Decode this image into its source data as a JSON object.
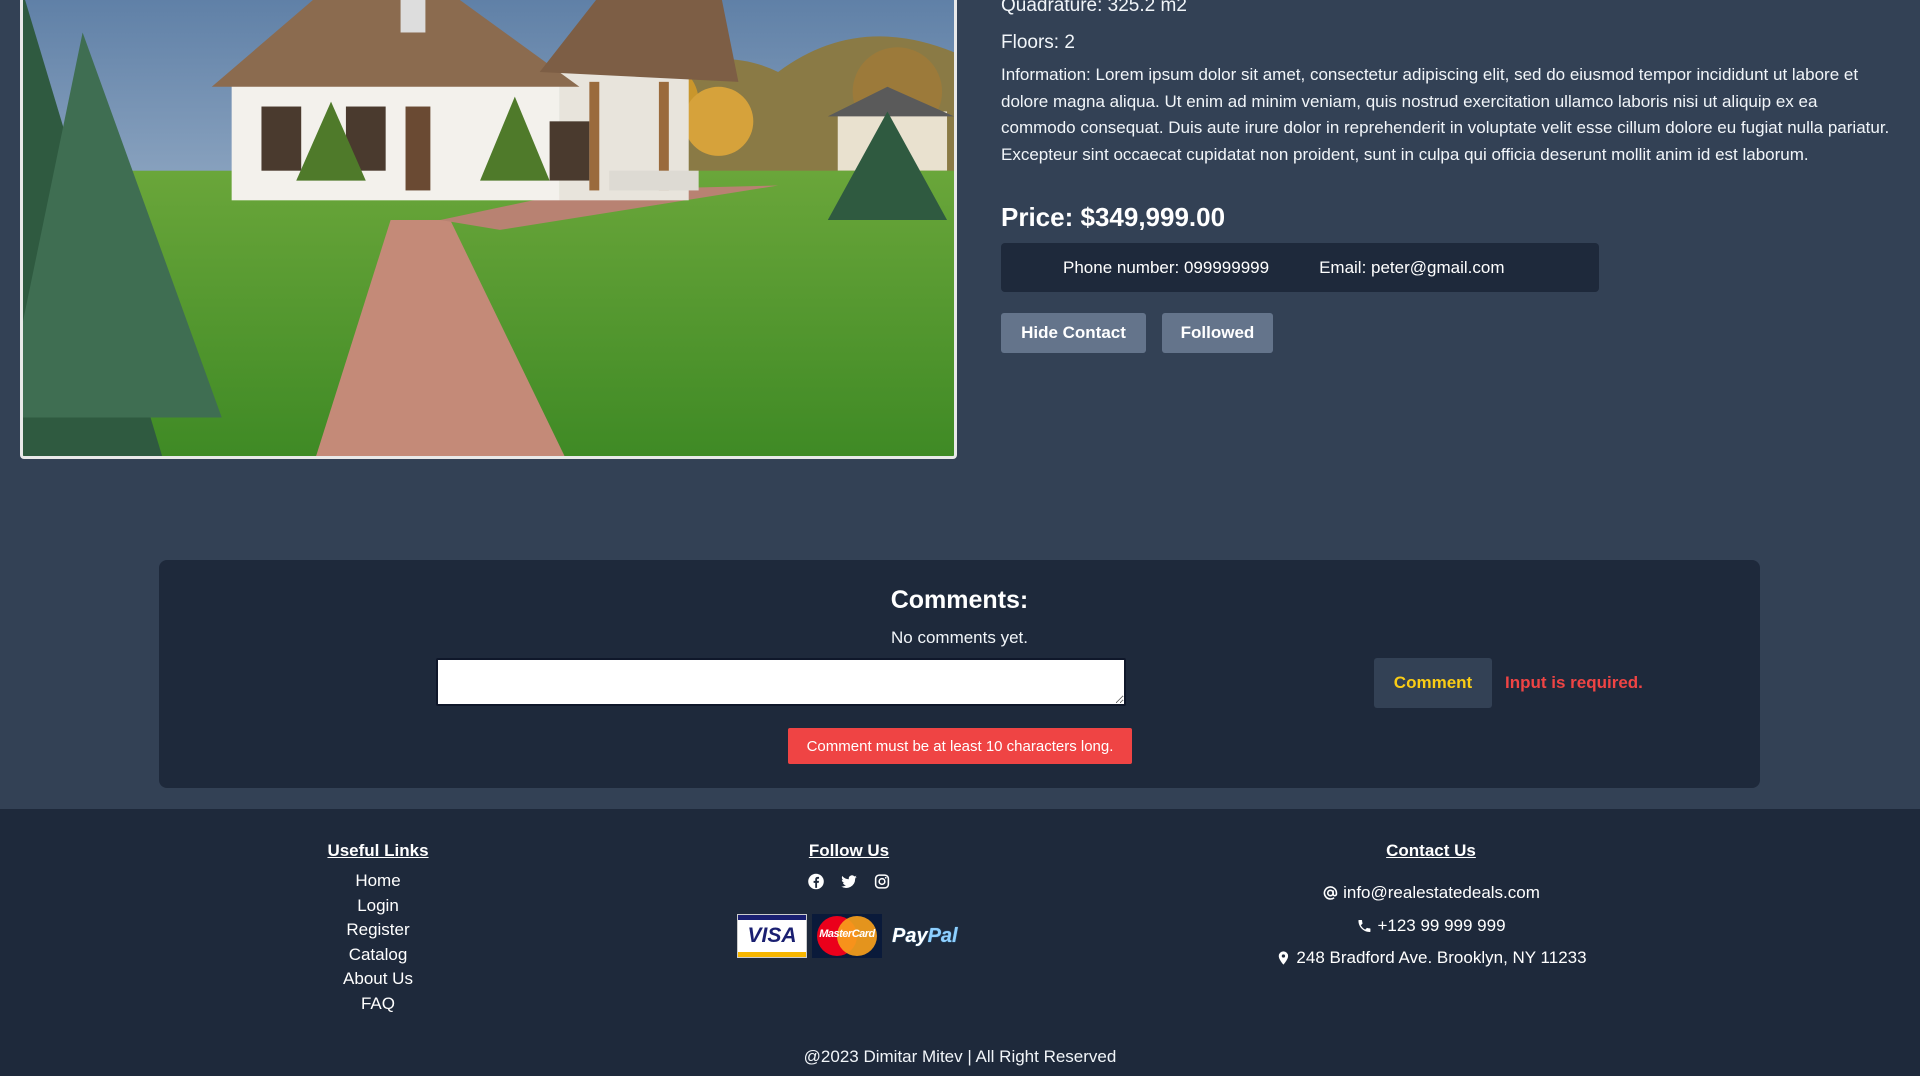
{
  "property": {
    "quadrature": "Quadrature: 325.2 m2",
    "floors": "Floors: 2",
    "information": "Information: Lorem ipsum dolor sit amet, consectetur adipiscing elit, sed do eiusmod tempor incididunt ut labore et dolore magna aliqua. Ut enim ad minim veniam, quis nostrud exercitation ullamco laboris nisi ut aliquip ex ea commodo consequat. Duis aute irure dolor in reprehenderit in voluptate velit esse cillum dolore eu fugiat nulla pariatur. Excepteur sint occaecat cupidatat non proident, sunt in culpa qui officia deserunt mollit anim id est laborum.",
    "price": "Price: $349,999.00",
    "phone": "Phone number: 099999999",
    "email": "Email: peter@gmail.com"
  },
  "actions": {
    "hide_contact": "Hide Contact",
    "followed": "Followed"
  },
  "comments": {
    "title": "Comments:",
    "empty_text": "No comments yet.",
    "input_value": "",
    "submit_label": "Comment",
    "required_message": "Input is required.",
    "length_error": "Comment must be at least 10 characters long."
  },
  "footer": {
    "useful_links_title": "Useful Links",
    "links": [
      "Home",
      "Login",
      "Register",
      "Catalog",
      "About Us",
      "FAQ"
    ],
    "follow_title": "Follow Us",
    "social_icons": [
      "facebook-icon",
      "twitter-icon",
      "instagram-icon"
    ],
    "payments": {
      "visa": "VISA",
      "mastercard": "MasterCard",
      "paypal_pay": "Pay",
      "paypal_pal": "Pal"
    },
    "contact_title": "Contact Us",
    "contact_email": "info@realestatedeals.com",
    "contact_phone": "+123 99 999 999",
    "contact_address": "248 Bradford Ave. Brooklyn, NY 11233",
    "copyright": "@2023 Dimitar Mitev | All Right Reserved"
  },
  "colors": {
    "page_bg": "#334155",
    "panel_bg": "#1e293b",
    "button_bg": "#64748b",
    "accent_yellow": "#facc15",
    "error_red": "#ef4444"
  }
}
